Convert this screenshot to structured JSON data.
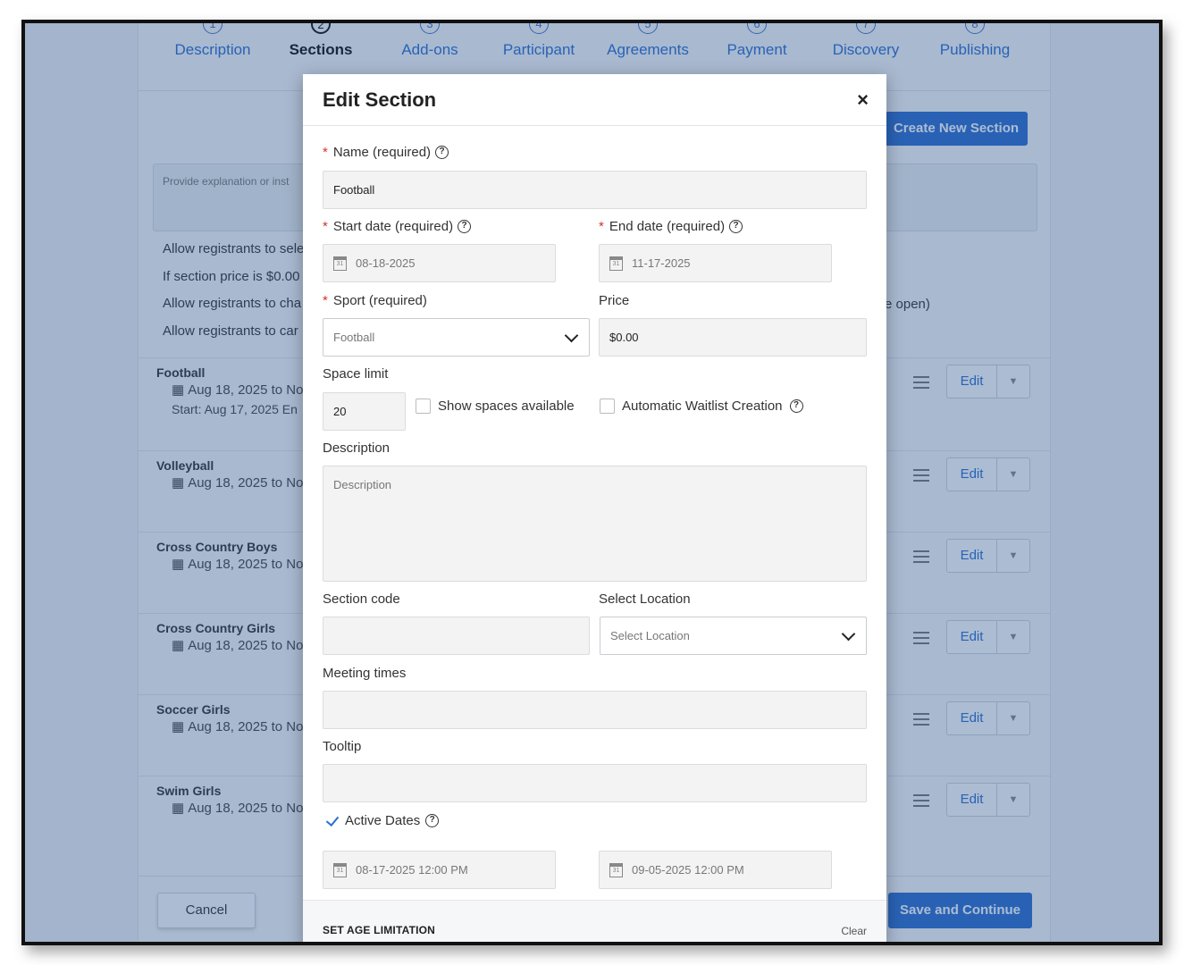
{
  "steps": [
    {
      "num": "1",
      "label": "Description"
    },
    {
      "num": "2",
      "label": "Sections"
    },
    {
      "num": "3",
      "label": "Add-ons"
    },
    {
      "num": "4",
      "label": "Participant"
    },
    {
      "num": "5",
      "label": "Agreements"
    },
    {
      "num": "6",
      "label": "Payment"
    },
    {
      "num": "7",
      "label": "Discovery"
    },
    {
      "num": "8",
      "label": "Publishing"
    }
  ],
  "page": {
    "create_button": "Create New Section",
    "explanation_placeholder": "Provide explanation or inst",
    "options": [
      "Allow registrants to sele",
      "If section price is $0.00",
      "Allow registrants to cha",
      "Allow registrants to car"
    ],
    "option_tail": "e open)",
    "sections": [
      {
        "name": "Football",
        "dates": "Aug 18, 2025 to No",
        "start": "Start: Aug 17, 2025 En",
        "edit": "Edit"
      },
      {
        "name": "Volleyball",
        "dates": "Aug 18, 2025 to No",
        "start": "",
        "edit": "Edit"
      },
      {
        "name": "Cross Country Boys",
        "dates": "Aug 18, 2025 to No",
        "start": "",
        "edit": "Edit"
      },
      {
        "name": "Cross Country Girls",
        "dates": "Aug 18, 2025 to No",
        "start": "",
        "edit": "Edit"
      },
      {
        "name": "Soccer Girls",
        "dates": "Aug 18, 2025 to No",
        "start": "",
        "edit": "Edit"
      },
      {
        "name": "Swim Girls",
        "dates": "Aug 18, 2025 to No",
        "start": "",
        "edit": "Edit"
      }
    ],
    "cancel_button": "Cancel",
    "save_button": "Save and Continue"
  },
  "modal": {
    "title": "Edit Section",
    "close_icon": "×",
    "required_mark": "*",
    "help_glyph": "?",
    "calendar_glyph": "31",
    "name_label": "Name (required)",
    "name_value": "Football",
    "start_label": "Start date (required)",
    "start_value": "08-18-2025",
    "end_label": "End date (required)",
    "end_value": "11-17-2025",
    "sport_label": "Sport (required)",
    "sport_value": "Football",
    "price_label": "Price",
    "price_value": "$0.00",
    "space_label": "Space limit",
    "space_value": "20",
    "show_spaces_label": "Show spaces available",
    "show_spaces_checked": false,
    "waitlist_label": "Automatic Waitlist Creation",
    "waitlist_checked": false,
    "description_label": "Description",
    "description_placeholder": "Description",
    "section_code_label": "Section code",
    "section_code_value": "",
    "location_label": "Select Location",
    "location_value": "Select Location",
    "meeting_label": "Meeting times",
    "meeting_value": "",
    "tooltip_label": "Tooltip",
    "tooltip_value": "",
    "active_dates_label": "Active Dates",
    "active_dates_checked": true,
    "active_start": "08-17-2025 12:00 PM",
    "active_end": "09-05-2025 12:00 PM",
    "age_title": "SET AGE LIMITATION",
    "age_clear": "Clear"
  }
}
